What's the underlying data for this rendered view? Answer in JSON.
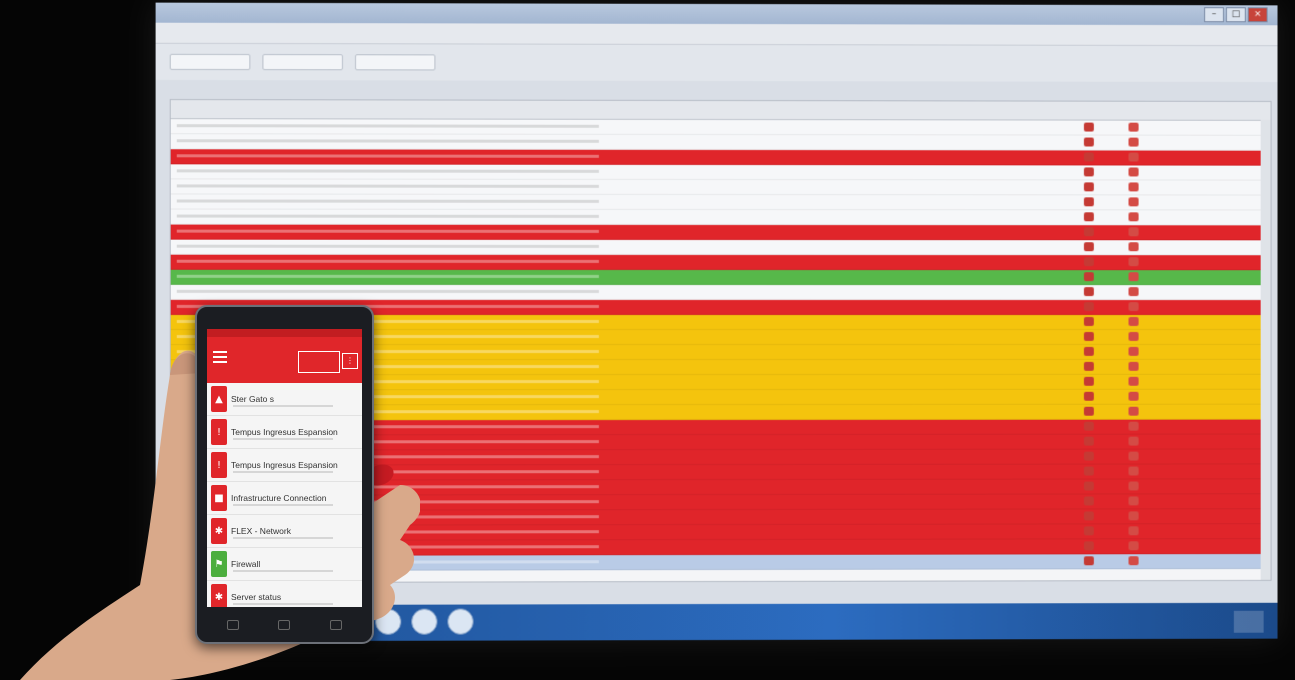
{
  "colors": {
    "background": "#050505",
    "alert_red": "#e0252a",
    "warning_yellow": "#f4c40d",
    "ok_green": "#57b84a",
    "selected_blue": "#b9cbe6",
    "taskbar": "#2c6cc0",
    "app_red": "#e0262a"
  },
  "desktop_grid": {
    "row_status": [
      "white",
      "white",
      "red",
      "white",
      "white",
      "white",
      "white",
      "red",
      "white",
      "red",
      "green",
      "white",
      "red",
      "yellow",
      "yellow",
      "yellow",
      "yellow",
      "yellow",
      "yellow",
      "yellow",
      "red",
      "red",
      "red",
      "red",
      "red",
      "red",
      "red",
      "red",
      "red",
      "select"
    ]
  },
  "phone_app": {
    "header_badge": "",
    "menu_items": [
      {
        "label": "Ster Gato s",
        "color": "red",
        "icon": "bell-icon"
      },
      {
        "label": "Tempus Ingresus Espansion",
        "color": "red",
        "icon": "alert-icon"
      },
      {
        "label": "Tempus Ingresus Espansion",
        "color": "red",
        "icon": "alert-icon"
      },
      {
        "label": "Infrastructure Connection",
        "color": "red",
        "icon": "lock-icon"
      },
      {
        "label": "FLEX - Network",
        "color": "red",
        "icon": "gear-icon"
      },
      {
        "label": "Firewall",
        "color": "green",
        "icon": "flag-icon"
      },
      {
        "label": "Server status",
        "color": "red",
        "icon": "gear-icon"
      }
    ]
  }
}
